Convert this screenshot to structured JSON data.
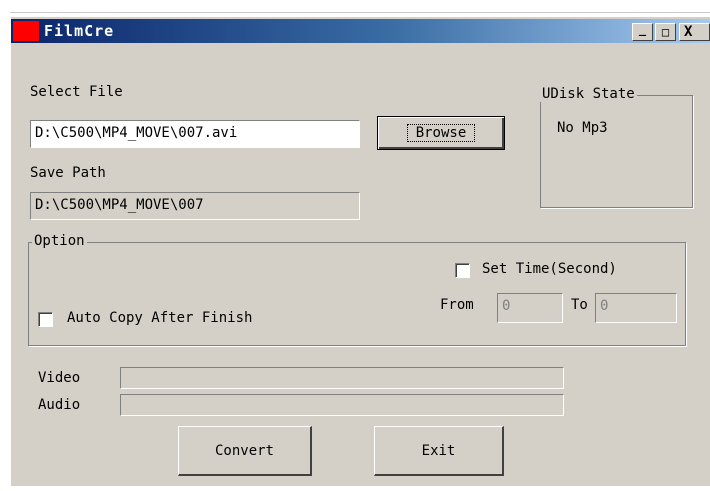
{
  "window": {
    "title": "FilmCre",
    "minimize_glyph": "_",
    "maximize_glyph": "□",
    "close_glyph": "X"
  },
  "select_file": {
    "label": "Select File",
    "value": "D:\\C500\\MP4_MOVE\\007.avi",
    "browse_label": "Browse"
  },
  "save_path": {
    "label": "Save Path",
    "value": "D:\\C500\\MP4_MOVE\\007"
  },
  "udisk": {
    "title": "UDisk State",
    "status": "No Mp3"
  },
  "option": {
    "title": "Option",
    "set_time_label": "Set Time(Second)",
    "set_time_checked": false,
    "from_label": "From",
    "from_value": "0",
    "to_label": "To",
    "to_value": "0",
    "auto_copy_label": "Auto Copy After Finish",
    "auto_copy_checked": false
  },
  "progress": {
    "video_label": "Video",
    "video_fraction": 0,
    "audio_label": "Audio",
    "audio_fraction": 0
  },
  "buttons": {
    "convert": "Convert",
    "exit": "Exit"
  }
}
